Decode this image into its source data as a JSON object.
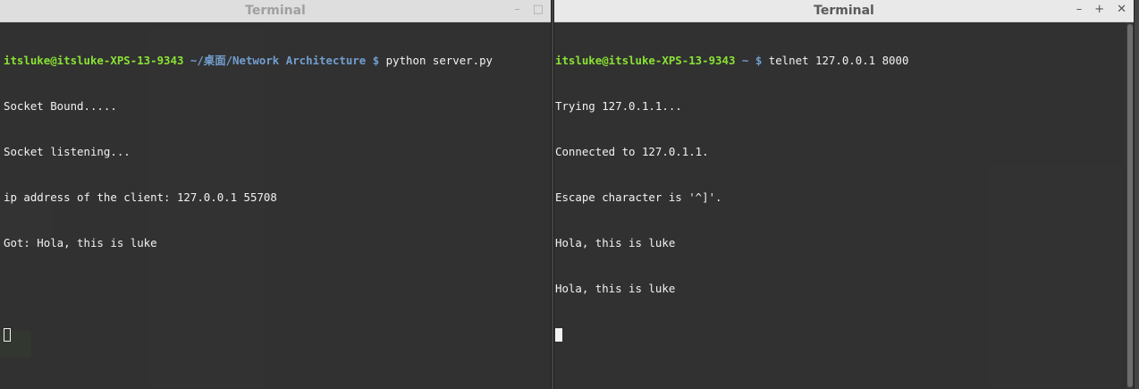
{
  "left_terminal": {
    "title": "Terminal",
    "controls": [
      "–",
      "□"
    ],
    "prompt": {
      "user_host": "itsluke@itsluke-XPS-13-9343",
      "path": "~/桌面/Network Architecture",
      "symbol": "$",
      "command": "python server.py"
    },
    "output": [
      "Socket Bound.....",
      "Socket listening...",
      "ip address of the client: 127.0.0.1 55708",
      "Got: Hola, this is luke"
    ]
  },
  "right_terminal": {
    "title": "Terminal",
    "controls": [
      "–",
      "+",
      "✕"
    ],
    "prompt": {
      "user_host": "itsluke@itsluke-XPS-13-9343",
      "path": "~",
      "symbol": "$",
      "command": "telnet 127.0.0.1 8000"
    },
    "output": [
      "Trying 127.0.1.1...",
      "Connected to 127.0.1.1.",
      "Escape character is '^]'.",
      "Hola, this is luke",
      "Hola, this is luke"
    ]
  }
}
